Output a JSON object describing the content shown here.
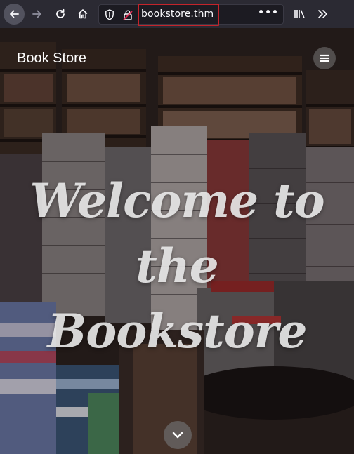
{
  "browser": {
    "url": "bookstore.thm",
    "page_actions_label": "•••"
  },
  "page": {
    "brand": "Book Store",
    "hero_lines": [
      "Welcome to",
      "the",
      "Bookstore"
    ]
  },
  "icons": {
    "back": "back-arrow-icon",
    "forward": "forward-arrow-icon",
    "reload": "reload-icon",
    "home": "home-icon",
    "tracking": "shield-icon",
    "insecure": "insecure-lock-icon",
    "library": "library-icon",
    "overflow": "overflow-chevrons-icon",
    "menu": "hamburger-menu-icon",
    "scroll": "chevron-down-icon"
  },
  "colors": {
    "toolbar": "#2b2a33",
    "urlbar": "#1c1b22",
    "highlight": "#c4242b"
  }
}
